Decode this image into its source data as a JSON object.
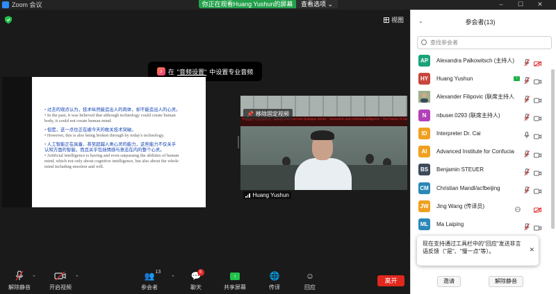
{
  "window": {
    "title": "Zoom 会议",
    "share_banner": "你正在观看Huang Yushun的屏幕",
    "view_options": "查看选项 ⌄"
  },
  "meeting": {
    "view_label": "视图",
    "audio_toast": {
      "prefix": "在",
      "link": "\"音频设置\"",
      "suffix": "中设置专业音频"
    },
    "slide": {
      "lines": [
        {
          "lang": "cn",
          "text": "• 过去的观点认为，技术纵然能造出人的肉体，却不能造出人的心灵。"
        },
        {
          "lang": "en",
          "text": "• In the past, it was believed that although technology could create human"
        },
        {
          "lang": "en",
          "text": "body, it could not create human mind."
        },
        {
          "lang": "gap",
          "text": ""
        },
        {
          "lang": "cn",
          "text": "• 但是，这一点也正在被今天的枚关技术突破。"
        },
        {
          "lang": "en",
          "text": "• However, this is also being broken through by today's technology."
        },
        {
          "lang": "gap",
          "text": ""
        },
        {
          "lang": "cn",
          "text": "• 人工智能正在具备、甚至超越人类心灵的能力，这些能力不仅关乎"
        },
        {
          "lang": "cn",
          "text": "认知方面的智能，而且关乎包括情感与意志在内的整个心灵。"
        },
        {
          "lang": "en",
          "text": "• Artificial intelligence is having and even surpassing the abilities of human"
        },
        {
          "lang": "en",
          "text": "mind, which not only about cognitive intelligence, but also about the whole"
        },
        {
          "lang": "en",
          "text": "mind including emotion and will."
        }
      ]
    },
    "video": {
      "unpin_label": "移除固定视频",
      "name": "Huang Yushun",
      "banner_text": "中德国学对话会系列 · 第四场  Sino-German Dialogue Series · Humanism and Artificial Intelligence · The Nature of Humanity and the Future of AI · Dialogue on Humanism"
    }
  },
  "toolbar": {
    "unmute": "解除静音",
    "start_video": "开启视频",
    "participants": "参会者",
    "participants_count": "13",
    "chat": "聊天",
    "chat_badge": "5",
    "share": "共享屏幕",
    "interpret": "传译",
    "reactions": "回应",
    "leave": "离开"
  },
  "panel": {
    "title": "参会者(13)",
    "search_placeholder": "查找参会者",
    "participants": [
      {
        "initials": "AP",
        "color": "#1aa37a",
        "name": "Alexandra Palkowitsch (主持人)",
        "mic": "muted",
        "cam": "off",
        "share": false
      },
      {
        "initials": "HY",
        "color": "#c8463c",
        "name": "Huang Yushun",
        "mic": "muted",
        "cam": "on",
        "share": true
      },
      {
        "initials": "",
        "color": "#8a9a7a",
        "name": "Alexander Filipovic (联席主持人)",
        "mic": "muted",
        "cam": "on",
        "share": false,
        "photo": true
      },
      {
        "initials": "N",
        "color": "#b340b8",
        "name": "nbuser.0293 (联席主持人)",
        "mic": "muted",
        "cam": "on",
        "share": false
      },
      {
        "initials": "ID",
        "color": "#f0a020",
        "name": "Interpreter Dr. Cai",
        "mic": "on",
        "cam": "on",
        "share": false
      },
      {
        "initials": "AI",
        "color": "#f0a020",
        "name": "Advanced Institute for Confucian Studies",
        "mic": "muted",
        "cam": "on",
        "share": false
      },
      {
        "initials": "BS",
        "color": "#3c4a5a",
        "name": "Benjamin STEUER",
        "mic": "muted",
        "cam": "on",
        "share": false
      },
      {
        "initials": "CM",
        "color": "#2a88b8",
        "name": "Christian Mandl/acfbeijing",
        "mic": "muted",
        "cam": "on",
        "share": false
      },
      {
        "initials": "JW",
        "color": "#f0a020",
        "name": "Jing Wang (传译员)",
        "mic": "globe",
        "cam": "off",
        "share": false
      },
      {
        "initials": "ML",
        "color": "#2a88b8",
        "name": "Ma Laiping",
        "mic": "muted",
        "cam": "on",
        "share": false
      }
    ],
    "toast": "现在支持通过工具栏中的\"回应\"发送非言语反馈（\"是\"、\"慢一点\"等）。",
    "invite": "邀请",
    "unmute_self": "解除静音"
  }
}
